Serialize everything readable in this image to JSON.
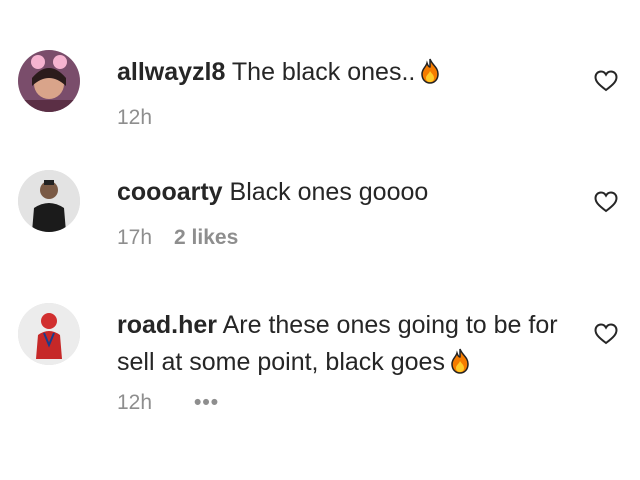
{
  "comments": [
    {
      "username": "allwayzl8",
      "text": "The black ones..",
      "emoji": "fire",
      "time": "12h",
      "likes": ""
    },
    {
      "username": "coooarty",
      "text": "Black ones goooo",
      "emoji": "",
      "time": "17h",
      "likes": "2 likes"
    },
    {
      "username": "road.her",
      "text": "Are these ones going to be for sell at some point, black goes",
      "emoji": "fire",
      "time": "12h",
      "likes": "",
      "more": "•••"
    }
  ],
  "icons": {
    "like": "heart-outline-icon",
    "emoji": "fire-emoji-icon"
  },
  "colors": {
    "text": "#262626",
    "secondary": "#8e8e8e",
    "fire": "#f57c00"
  }
}
